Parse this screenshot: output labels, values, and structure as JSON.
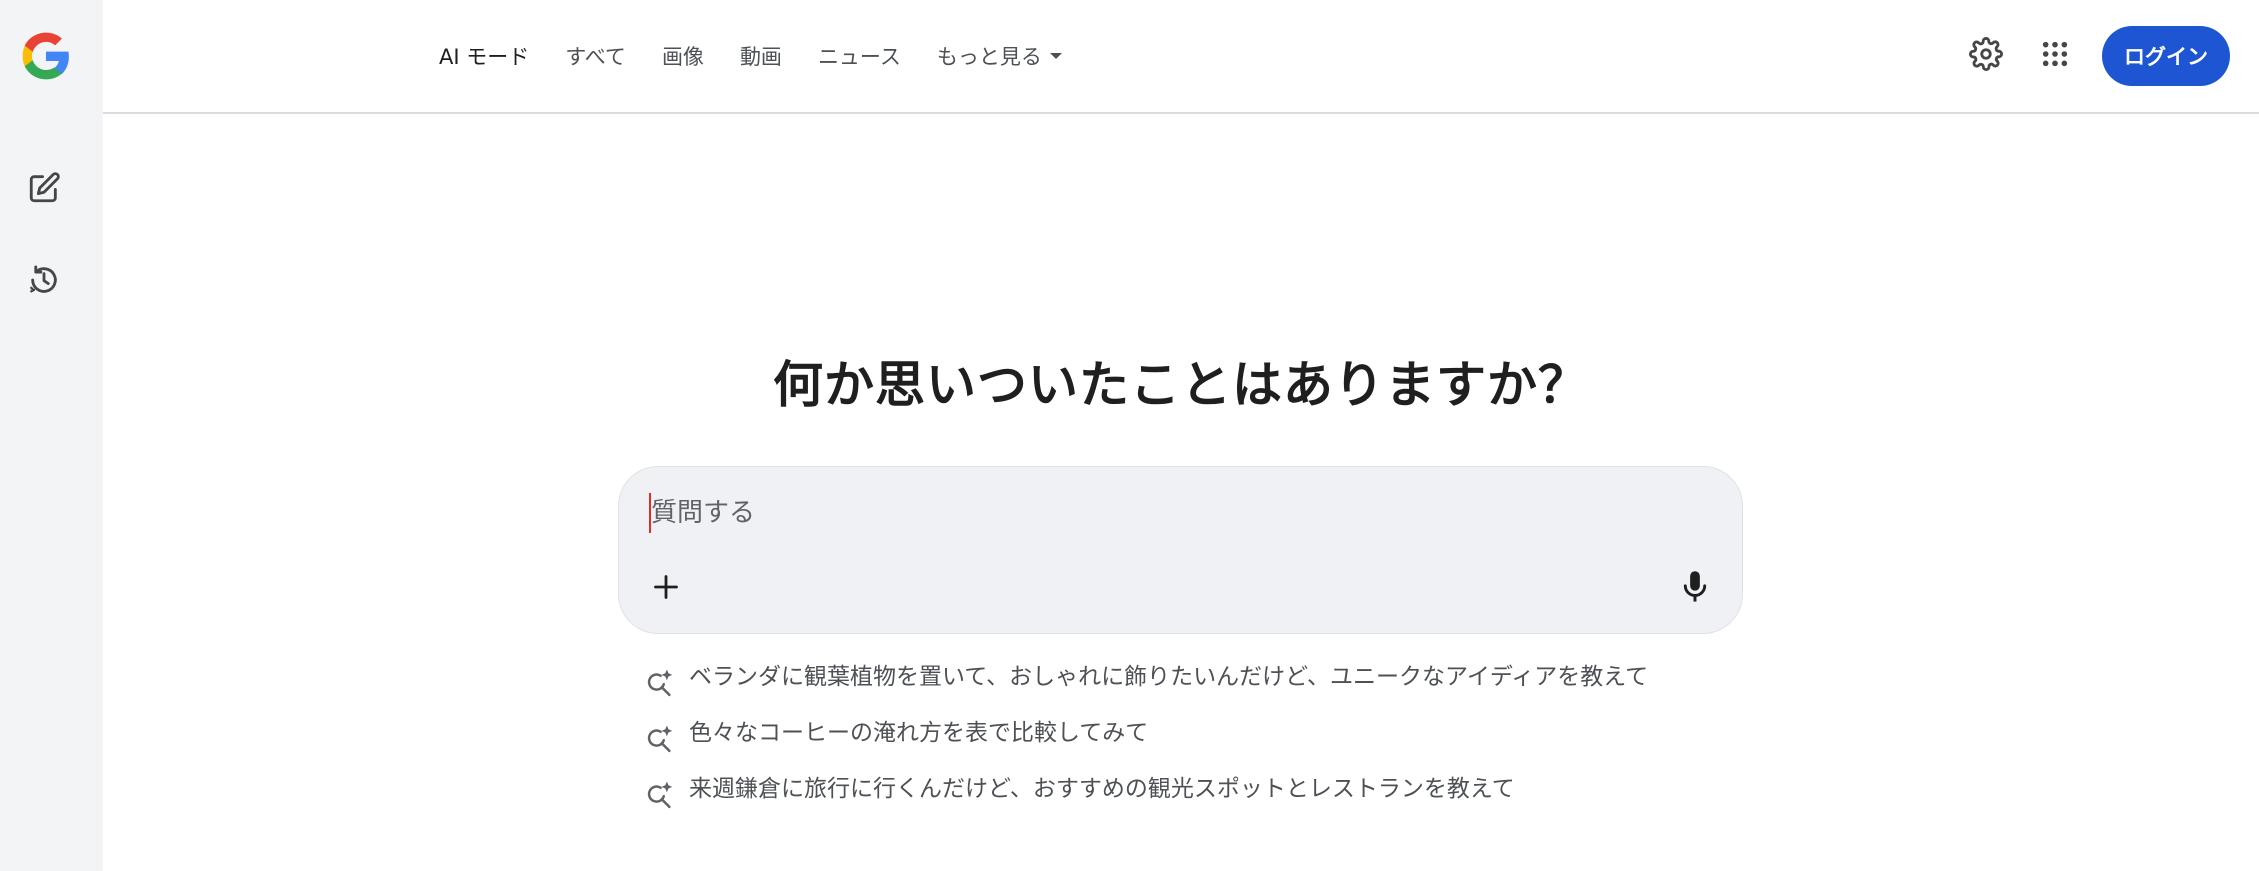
{
  "nav": {
    "tabs": [
      {
        "label": "AI モード"
      },
      {
        "label": "すべて"
      },
      {
        "label": "画像"
      },
      {
        "label": "動画"
      },
      {
        "label": "ニュース"
      },
      {
        "label": "もっと見る"
      }
    ]
  },
  "header": {
    "login_label": "ログイン"
  },
  "main": {
    "headline": "何か思いついたことはありますか？",
    "search_placeholder": "質問する"
  },
  "suggestions": [
    {
      "text": "ベランダに観葉植物を置いて、おしゃれに飾りたいんだけど、ユニークなアイディアを教えて"
    },
    {
      "text": "色々なコーヒーの淹れ方を表で比較してみて"
    },
    {
      "text": "来週鎌倉に旅行に行くんだけど、おすすめの観光スポットとレストランを教えて"
    }
  ],
  "icons": {
    "logo": "google-g-logo",
    "new_chat": "edit-square-icon",
    "history": "history-icon",
    "settings": "gear-icon",
    "apps": "apps-grid-icon",
    "add": "plus-icon",
    "mic": "microphone-icon",
    "suggestion": "search-spark-icon"
  },
  "colors": {
    "accent": "#1e55d2",
    "sidebar_bg": "#f3f4f6",
    "searchbox_bg": "#eff1f5"
  }
}
